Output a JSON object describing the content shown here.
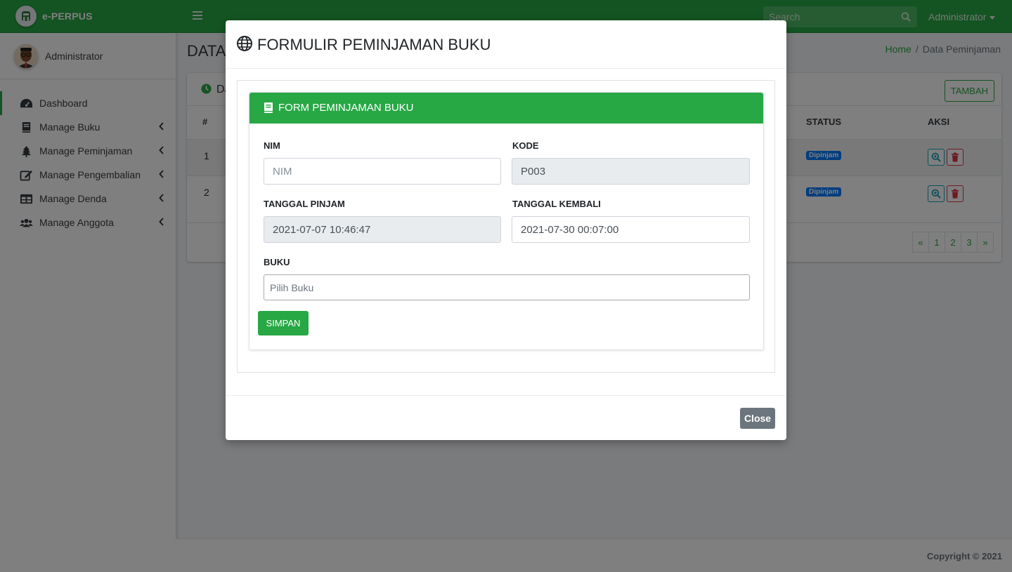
{
  "brand": {
    "name": "e-PERPUS"
  },
  "user": {
    "name": "Administrator"
  },
  "sidebar": {
    "items": [
      {
        "label": "Dashboard",
        "icon": "tachometer-icon"
      },
      {
        "label": "Manage Buku",
        "icon": "book-icon"
      },
      {
        "label": "Manage Peminjaman",
        "icon": "tree-icon"
      },
      {
        "label": "Manage Pengembalian",
        "icon": "edit-icon"
      },
      {
        "label": "Manage Denda",
        "icon": "table-icon"
      },
      {
        "label": "Manage Anggota",
        "icon": "users-icon"
      }
    ]
  },
  "topbar": {
    "search_placeholder": "Search",
    "user_label": "Administrator"
  },
  "content": {
    "title": "DATA",
    "breadcrumb": {
      "home": "Home",
      "separator": "/",
      "current": "Data Peminjaman"
    },
    "card_title": "Da",
    "add_label": "TAMBAH",
    "table": {
      "headers": {
        "num": "#",
        "status": "STATUS",
        "actions": "AKSI"
      },
      "rows": [
        {
          "num": "1",
          "status": "Dipinjam"
        },
        {
          "num": "2",
          "status": "Dipinjam"
        }
      ]
    },
    "pagination": [
      "«",
      "1",
      "2",
      "3",
      "»"
    ]
  },
  "footer": {
    "copyright": "Copyright © 2021"
  },
  "modal": {
    "title": "FORMULIR PEMINJAMAN BUKU",
    "form_title": "FORM PEMINJAMAN BUKU",
    "fields": {
      "nim": {
        "label": "NIM",
        "placeholder": "NIM",
        "value": ""
      },
      "kode": {
        "label": "KODE",
        "value": "P003"
      },
      "tanggal_pinjam": {
        "label": "TANGGAL PINJAM",
        "value": "2021-07-07 10:46:47"
      },
      "tanggal_kembali": {
        "label": "TANGGAL KEMBALI",
        "value": "2021-07-30 00:07:00"
      },
      "buku": {
        "label": "BUKU",
        "placeholder": "Pilih Buku"
      }
    },
    "submit_label": "SIMPAN",
    "close_label": "Close"
  },
  "colors": {
    "primary": "#28a745",
    "info": "#17a2b8",
    "danger": "#dc3545",
    "badge": "#007bff",
    "secondary": "#6c757d"
  }
}
